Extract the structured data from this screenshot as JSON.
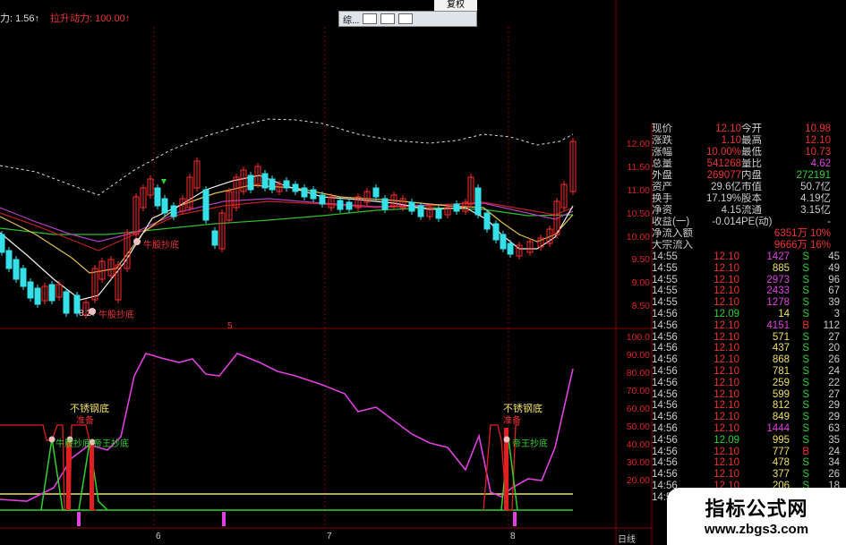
{
  "header": {
    "left_label": "力: 1.56↑",
    "left_label2": "拉升动力: 100.00↑",
    "fuquan": "复权",
    "popup_text": "综..."
  },
  "colors": {
    "up": "#ff2a2a",
    "down": "#35e0e8",
    "pink": "#e040e0",
    "yellow": "#f0e060",
    "green": "#30d030",
    "grid": "#8b0000"
  },
  "price_axis": [
    "12.00",
    "11.50",
    "11.00",
    "10.50",
    "10.00",
    "9.50",
    "9.00",
    "8.50"
  ],
  "osc_axis": [
    "100.0",
    "90.00",
    "80.00",
    "70.00",
    "60.00",
    "50.00",
    "40.00",
    "30.00",
    "20.00"
  ],
  "annotations": {
    "low_price": "8.27",
    "bull_bottom": "牛股抄底",
    "bull_bottom2": "牛股抄底",
    "stainless1": "不锈钢底",
    "stainless2": "不锈钢底",
    "ready1": "准备",
    "ready2": "准备",
    "king1": "帝王抄底",
    "king2": "帝王抄底",
    "bull3": "牛股抄底",
    "num5": "5",
    "date6": "6",
    "date7": "7",
    "date8": "8",
    "rix": "日线"
  },
  "quote": [
    {
      "l1": "现价",
      "v1": "12.10",
      "l2": "今开",
      "v2": "10.98"
    },
    {
      "l1": "涨跌",
      "v1": "1.10",
      "l2": "最高",
      "v2": "12.10"
    },
    {
      "l1": "涨幅",
      "v1": "10.00%",
      "l2": "最低",
      "v2": "10.73"
    },
    {
      "l1": "总量",
      "v1": "541268",
      "l2": "量比",
      "v2": "4.62"
    },
    {
      "l1": "外盘",
      "v1": "269077",
      "l2": "内盘",
      "v2": "272191"
    },
    {
      "l1": "资产",
      "v1": "29.6亿",
      "l2": "市值",
      "v2": "50.7亿"
    },
    {
      "l1": "换手",
      "v1": "17.19%",
      "l2": "股本",
      "v2": "4.19亿"
    },
    {
      "l1": "净资",
      "v1": "4.15",
      "l2": "流通",
      "v2": "3.15亿"
    },
    {
      "l1": "收益(一)",
      "v1": "-0.014",
      "l2": "PE(动)",
      "v2": "-"
    }
  ],
  "netflow": [
    {
      "label": "净流入额",
      "value": "6351万",
      "pct": "10%"
    },
    {
      "label": "大宗流入",
      "value": "9666万",
      "pct": "16%"
    }
  ],
  "ticks": [
    {
      "t": "14:55",
      "p": "12.10",
      "v": "1427",
      "s": "S",
      "n": "45"
    },
    {
      "t": "14:55",
      "p": "12.10",
      "v": "885",
      "s": "S",
      "n": "49"
    },
    {
      "t": "14:55",
      "p": "12.10",
      "v": "2973",
      "s": "S",
      "n": "96"
    },
    {
      "t": "14:55",
      "p": "12.10",
      "v": "2433",
      "s": "S",
      "n": "67"
    },
    {
      "t": "14:55",
      "p": "12.10",
      "v": "1278",
      "s": "S",
      "n": "39"
    },
    {
      "t": "14:56",
      "p": "12.09",
      "v": "14",
      "s": "S",
      "n": "3"
    },
    {
      "t": "14:56",
      "p": "12.10",
      "v": "4151",
      "s": "B",
      "n": "112"
    },
    {
      "t": "14:56",
      "p": "12.10",
      "v": "571",
      "s": "S",
      "n": "27"
    },
    {
      "t": "14:56",
      "p": "12.10",
      "v": "437",
      "s": "S",
      "n": "20"
    },
    {
      "t": "14:56",
      "p": "12.10",
      "v": "868",
      "s": "S",
      "n": "26"
    },
    {
      "t": "14:56",
      "p": "12.10",
      "v": "781",
      "s": "S",
      "n": "24"
    },
    {
      "t": "14:56",
      "p": "12.10",
      "v": "259",
      "s": "S",
      "n": "22"
    },
    {
      "t": "14:56",
      "p": "12.10",
      "v": "599",
      "s": "S",
      "n": "27"
    },
    {
      "t": "14:56",
      "p": "12.10",
      "v": "812",
      "s": "S",
      "n": "29"
    },
    {
      "t": "14:56",
      "p": "12.10",
      "v": "849",
      "s": "S",
      "n": "29"
    },
    {
      "t": "14:56",
      "p": "12.10",
      "v": "1444",
      "s": "S",
      "n": "63"
    },
    {
      "t": "14:56",
      "p": "12.09",
      "v": "995",
      "s": "S",
      "n": "35"
    },
    {
      "t": "14:56",
      "p": "12.10",
      "v": "777",
      "s": "B",
      "n": "24"
    },
    {
      "t": "14:56",
      "p": "12.10",
      "v": "478",
      "s": "S",
      "n": "34"
    },
    {
      "t": "14:56",
      "p": "12.10",
      "v": "377",
      "s": "S",
      "n": "26"
    },
    {
      "t": "14:56",
      "p": "12.10",
      "v": "206",
      "s": "S",
      "n": "18"
    },
    {
      "t": "14:56",
      "p": "12.10",
      "v": "595",
      "s": "S",
      "n": "23"
    }
  ],
  "watermark": {
    "title": "指标公式网",
    "url": "www.zbgs3.com"
  }
}
